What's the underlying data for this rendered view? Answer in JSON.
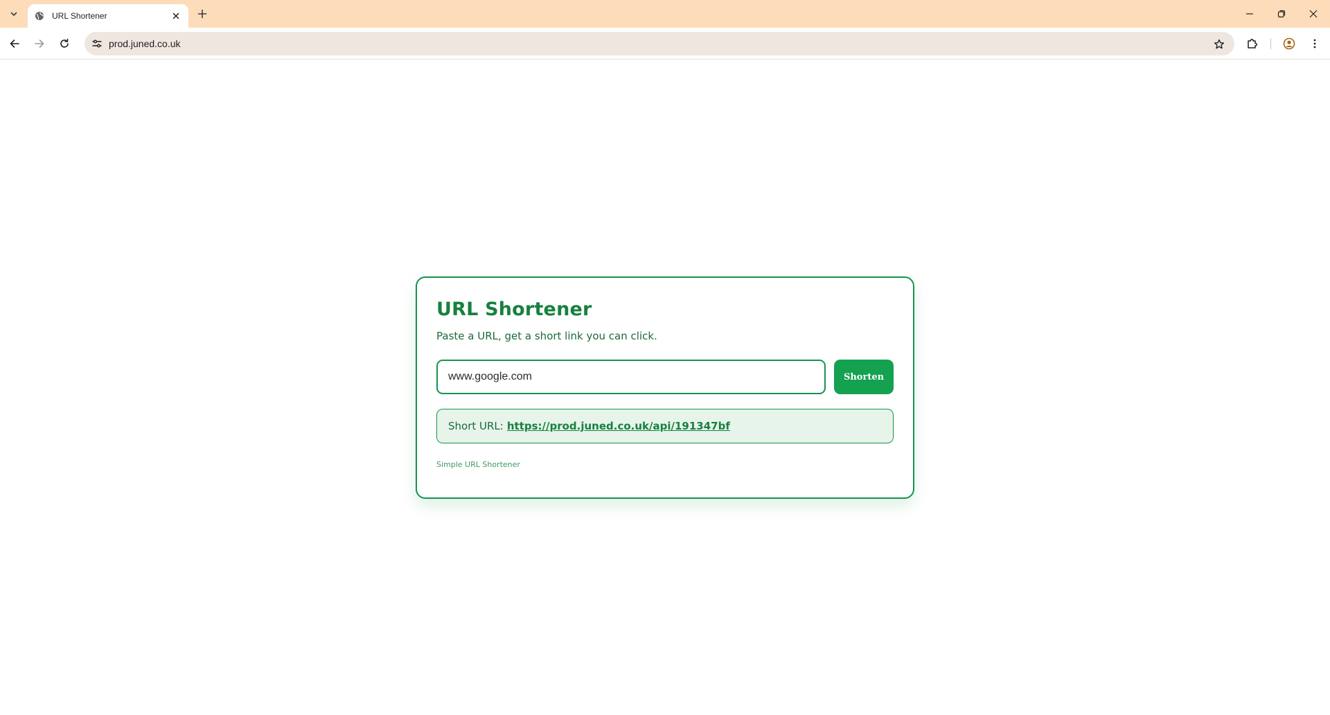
{
  "browser": {
    "tab": {
      "title": "URL Shortener"
    },
    "address_bar": {
      "url": "prod.juned.co.uk"
    }
  },
  "page": {
    "title": "URL Shortener",
    "subtitle": "Paste a URL, get a short link you can click.",
    "input": {
      "value": "www.google.com"
    },
    "shorten_button": "Shorten",
    "result": {
      "label": "Short URL:",
      "link": "https://prod.juned.co.uk/api/191347bf"
    },
    "footer": "Simple URL Shortener"
  },
  "colors": {
    "tabstrip": "#fddcba",
    "accent_green": "#14934a",
    "button_green": "#14a150",
    "result_bg": "#e7f4ea"
  }
}
